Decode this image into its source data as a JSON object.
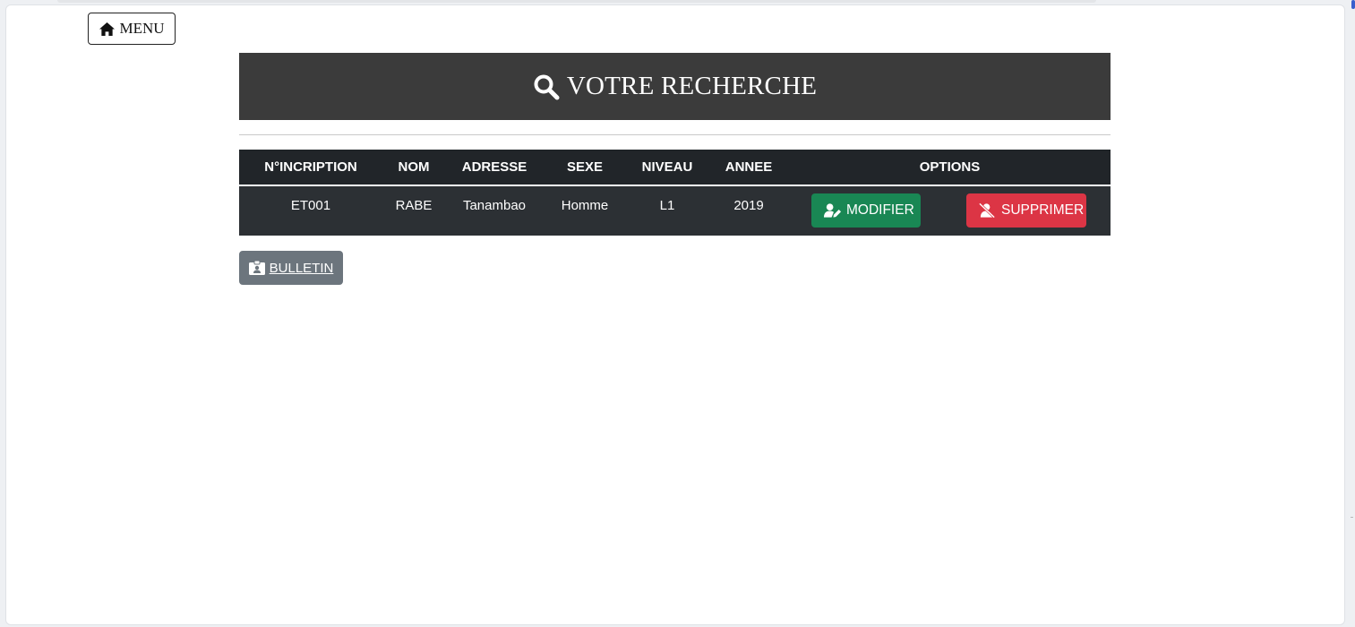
{
  "menu": {
    "label": "MENU",
    "icon": "home-icon"
  },
  "header": {
    "title": "VOTRE RECHERCHE",
    "icon": "search-icon",
    "background": "#3b3b3b"
  },
  "table": {
    "columns": [
      "N°INCRIPTION",
      "NOM",
      "ADRESSE",
      "SEXE",
      "NIVEAU",
      "ANNEE",
      "OPTIONS"
    ],
    "rows": [
      {
        "inscription": "ET001",
        "nom": "RABE",
        "adresse": "Tanambao",
        "sexe": "Homme",
        "niveau": "L1",
        "annee": "2019"
      }
    ],
    "actions": {
      "modifier": {
        "label": "MODIFIER",
        "icon": "user-edit-icon",
        "color": "#198754"
      },
      "supprimer": {
        "label": "SUPPRIMER",
        "icon": "user-remove-icon",
        "color": "#dc3545"
      }
    }
  },
  "bulletin": {
    "label": "BULLETIN",
    "icon": "id-badge-icon",
    "color": "#6c757d"
  }
}
